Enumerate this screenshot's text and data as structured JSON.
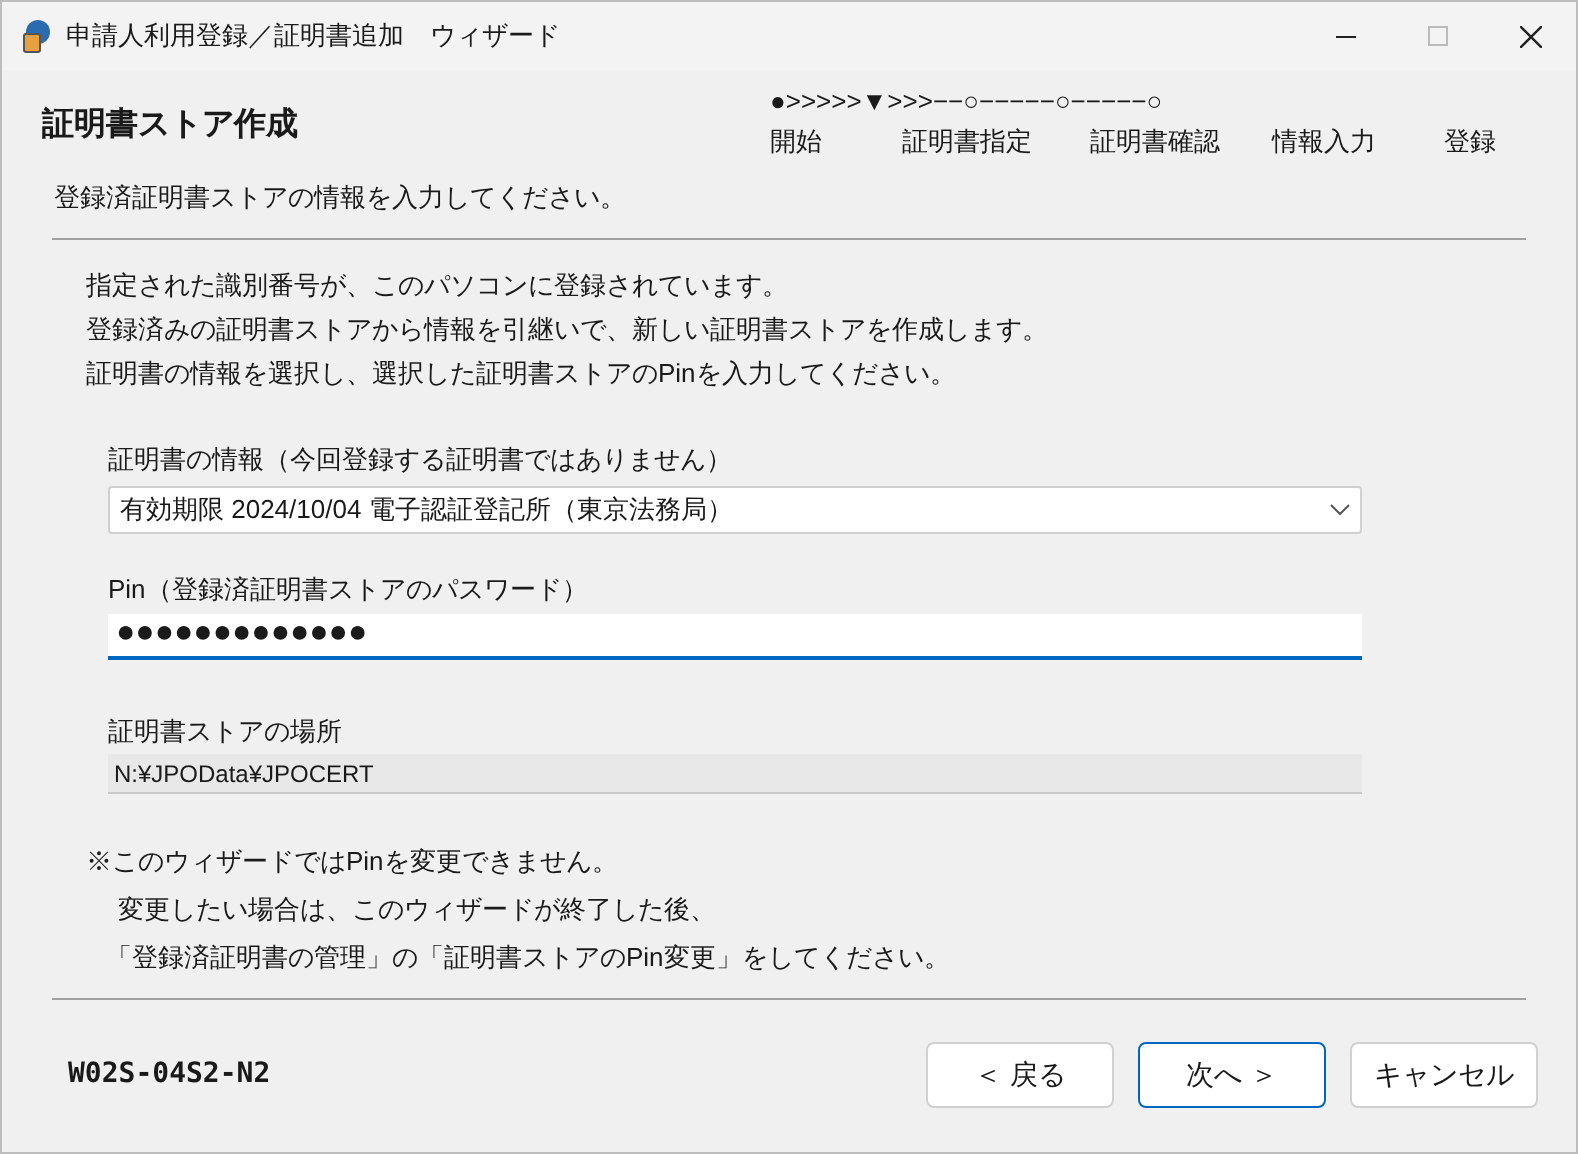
{
  "window": {
    "title": "申請人利用登録／証明書追加　ウィザード"
  },
  "header": {
    "title": "証明書ストア作成",
    "subtitle": "登録済証明書ストアの情報を入力してください。"
  },
  "progress": {
    "line": "●>>>>>▼>>>−−○−−−−−○−−−−−○",
    "steps": [
      "開始",
      "証明書指定",
      "証明書確認",
      "情報入力",
      "登録"
    ]
  },
  "intro": [
    "指定された識別番号が、このパソコンに登録されています。",
    "登録済みの証明書ストアから情報を引継いで、新しい証明書ストアを作成します。",
    "証明書の情報を選択し、選択した証明書ストアのPinを入力してください。"
  ],
  "certificate": {
    "label": "証明書の情報（今回登録する証明書ではありません）",
    "value": "有効期限 2024/10/04 電子認証登記所（東京法務局）"
  },
  "pin": {
    "label": "Pin（登録済証明書ストアのパスワード）",
    "value": "●●●●●●●●●●●●●",
    "focused": true
  },
  "location": {
    "label": "証明書ストアの場所",
    "value": "N:¥JPOData¥JPOCERT"
  },
  "note": [
    "※このウィザードではPinを変更できません。",
    "変更したい場合は、このウィザードが終了した後、",
    "「登録済証明書の管理」の「証明書ストアのPin変更」をしてください。"
  ],
  "footer": {
    "code": "W02S-04S2-N2",
    "buttons": [
      {
        "label": "＜ 戻る",
        "default": false
      },
      {
        "label": "次へ ＞",
        "default": true
      },
      {
        "label": "キャンセル",
        "default": false
      }
    ]
  }
}
